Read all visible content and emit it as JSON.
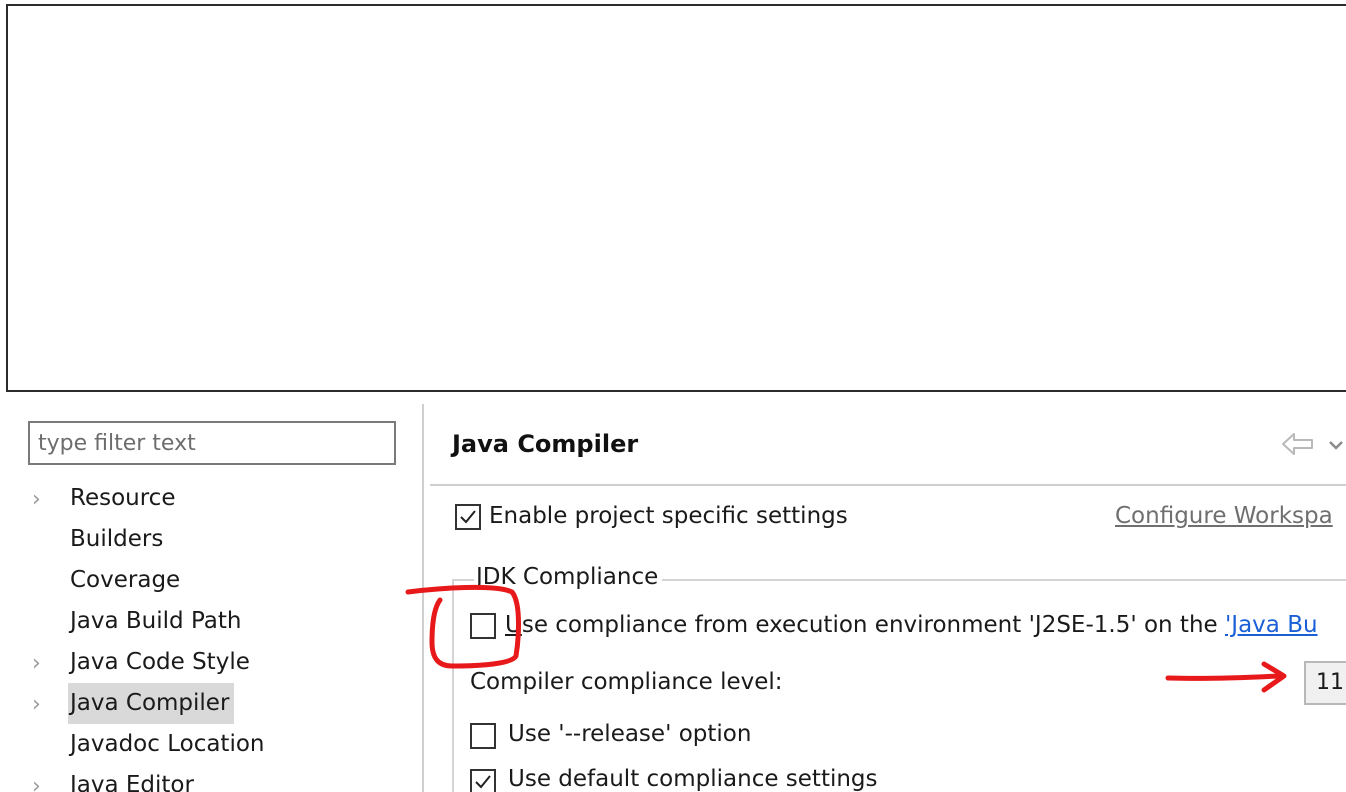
{
  "filter": {
    "placeholder": "type filter text"
  },
  "tree": {
    "items": [
      {
        "label": "Resource",
        "has_children": true
      },
      {
        "label": "Builders",
        "has_children": false
      },
      {
        "label": "Coverage",
        "has_children": false
      },
      {
        "label": "Java Build Path",
        "has_children": false
      },
      {
        "label": "Java Code Style",
        "has_children": true
      },
      {
        "label": "Java Compiler",
        "has_children": true,
        "selected": true
      },
      {
        "label": "Javadoc Location",
        "has_children": false
      },
      {
        "label": "Java Editor",
        "has_children": true
      }
    ]
  },
  "page": {
    "title": "Java Compiler",
    "icons": {
      "back": "back-arrow-icon",
      "menu": "view-menu-chevron-icon"
    }
  },
  "settings": {
    "enable_project_specific": {
      "label": "Enable project specific settings",
      "checked": true
    },
    "configure_workspace_link": "Configure Workspa",
    "jdk_group_title": "JDK Compliance",
    "use_exec_env": {
      "label_u": "U",
      "label_rest": "se compliance from execution environment 'J2SE-1.5' on the ",
      "link": "'Java Bu",
      "checked": false
    },
    "compliance_level": {
      "label": "Compiler compliance level:",
      "value": "11"
    },
    "use_release": {
      "label": "Use '--release' option",
      "checked": false
    },
    "use_default_compliance": {
      "label": "Use default compliance settings",
      "checked": true
    }
  },
  "annotations": {
    "color": "#e8191a"
  }
}
